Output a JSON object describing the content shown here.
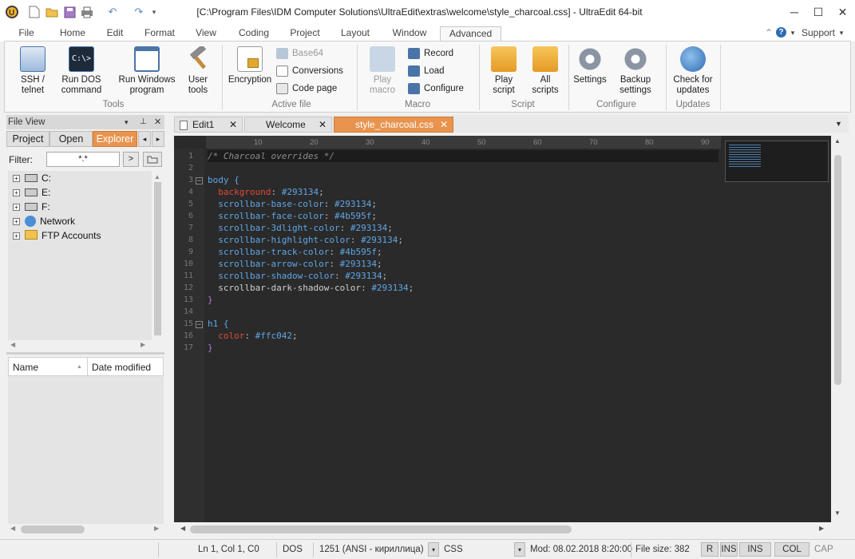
{
  "window": {
    "title": "[C:\\Program Files\\IDM Computer Solutions\\UltraEdit\\extras\\welcome\\style_charcoal.css] - UltraEdit 64-bit",
    "minimize": "─",
    "maximize": "☐",
    "close": "✕"
  },
  "menu_tabs": [
    "File",
    "Home",
    "Edit",
    "Format",
    "View",
    "Coding",
    "Project",
    "Layout",
    "Window",
    "Advanced"
  ],
  "support_label": "Support",
  "ribbon": {
    "tools": {
      "ssh": "SSH /",
      "ssh2": "telnet",
      "dos": "Run DOS",
      "dos2": "command",
      "win": "Run Windows",
      "win2": "program",
      "user": "User",
      "user2": "tools",
      "group": "Tools"
    },
    "active_file": {
      "encryption": "Encryption",
      "base64": "Base64",
      "conversions": "Conversions",
      "codepage": "Code page",
      "group": "Active file"
    },
    "macro": {
      "play": "Play",
      "play2": "macro",
      "record": "Record",
      "load": "Load",
      "configure": "Configure",
      "group": "Macro"
    },
    "script": {
      "play": "Play",
      "play2": "script",
      "all": "All",
      "all2": "scripts",
      "group": "Script"
    },
    "configure": {
      "settings": "Settings",
      "backup": "Backup",
      "backup2": "settings",
      "group": "Configure"
    },
    "updates": {
      "check": "Check for",
      "check2": "updates",
      "group": "Updates"
    }
  },
  "file_view": {
    "title": "File View",
    "tabs": [
      "Project",
      "Open",
      "Explorer"
    ],
    "filter_label": "Filter:",
    "filter_value": "*.*",
    "go_button": ">",
    "tree": [
      "C:",
      "E:",
      "F:",
      "Network",
      "FTP Accounts"
    ],
    "columns": [
      "Name",
      "Date modified"
    ]
  },
  "editor_tabs": [
    "Edit1",
    "Welcome",
    "style_charcoal.css"
  ],
  "ruler_marks": [
    "10",
    "20",
    "30",
    "40",
    "50",
    "60",
    "70",
    "80",
    "90"
  ],
  "code_lines": [
    {
      "n": "1",
      "parts": [
        {
          "t": "/* Charcoal overrides */",
          "c": "#8c8c8c",
          "i": true
        }
      ]
    },
    {
      "n": "2",
      "parts": []
    },
    {
      "n": "3",
      "parts": [
        {
          "t": "body {",
          "c": "#5fa7e8"
        }
      ]
    },
    {
      "n": "4",
      "parts": [
        {
          "t": "  background",
          "c": "#e04a3a"
        },
        {
          "t": ": ",
          "c": "#bbbbbb"
        },
        {
          "t": "#293134",
          "c": "#5fa7e8"
        },
        {
          "t": ";",
          "c": "#bbbbbb"
        }
      ]
    },
    {
      "n": "5",
      "parts": [
        {
          "t": "  scrollbar-base-color",
          "c": "#5fa7e8"
        },
        {
          "t": ": ",
          "c": "#bbbbbb"
        },
        {
          "t": "#293134",
          "c": "#5fa7e8"
        },
        {
          "t": ";",
          "c": "#bbbbbb"
        }
      ]
    },
    {
      "n": "6",
      "parts": [
        {
          "t": "  scrollbar-face-color",
          "c": "#5fa7e8"
        },
        {
          "t": ": ",
          "c": "#bbbbbb"
        },
        {
          "t": "#4b595f",
          "c": "#5fa7e8"
        },
        {
          "t": ";",
          "c": "#bbbbbb"
        }
      ]
    },
    {
      "n": "7",
      "parts": [
        {
          "t": "  scrollbar-3dlight-color",
          "c": "#5fa7e8"
        },
        {
          "t": ": ",
          "c": "#bbbbbb"
        },
        {
          "t": "#293134",
          "c": "#5fa7e8"
        },
        {
          "t": ";",
          "c": "#bbbbbb"
        }
      ]
    },
    {
      "n": "8",
      "parts": [
        {
          "t": "  scrollbar-highlight-color",
          "c": "#5fa7e8"
        },
        {
          "t": ": ",
          "c": "#bbbbbb"
        },
        {
          "t": "#293134",
          "c": "#5fa7e8"
        },
        {
          "t": ";",
          "c": "#bbbbbb"
        }
      ]
    },
    {
      "n": "9",
      "parts": [
        {
          "t": "  scrollbar-track-color",
          "c": "#5fa7e8"
        },
        {
          "t": ": ",
          "c": "#bbbbbb"
        },
        {
          "t": "#4b595f",
          "c": "#5fa7e8"
        },
        {
          "t": ";",
          "c": "#bbbbbb"
        }
      ]
    },
    {
      "n": "10",
      "parts": [
        {
          "t": "  scrollbar-arrow-color",
          "c": "#5fa7e8"
        },
        {
          "t": ": ",
          "c": "#bbbbbb"
        },
        {
          "t": "#293134",
          "c": "#5fa7e8"
        },
        {
          "t": ";",
          "c": "#bbbbbb"
        }
      ]
    },
    {
      "n": "11",
      "parts": [
        {
          "t": "  scrollbar-shadow-color",
          "c": "#5fa7e8"
        },
        {
          "t": ": ",
          "c": "#bbbbbb"
        },
        {
          "t": "#293134",
          "c": "#5fa7e8"
        },
        {
          "t": ";",
          "c": "#bbbbbb"
        }
      ]
    },
    {
      "n": "12",
      "parts": [
        {
          "t": "  scrollbar-dark-shadow-color",
          "c": "#cfcfcf"
        },
        {
          "t": ": ",
          "c": "#bbbbbb"
        },
        {
          "t": "#293134",
          "c": "#5fa7e8"
        },
        {
          "t": ";",
          "c": "#bbbbbb"
        }
      ]
    },
    {
      "n": "13",
      "parts": [
        {
          "t": "}",
          "c": "#b07ad8"
        }
      ]
    },
    {
      "n": "14",
      "parts": []
    },
    {
      "n": "15",
      "parts": [
        {
          "t": "h1 {",
          "c": "#5fa7e8"
        }
      ]
    },
    {
      "n": "16",
      "parts": [
        {
          "t": "  color",
          "c": "#e04a3a"
        },
        {
          "t": ": ",
          "c": "#bbbbbb"
        },
        {
          "t": "#ffc042",
          "c": "#5fa7e8"
        },
        {
          "t": ";",
          "c": "#bbbbbb"
        }
      ]
    },
    {
      "n": "17",
      "parts": [
        {
          "t": "}",
          "c": "#b07ad8"
        }
      ]
    }
  ],
  "status": {
    "position": "Ln 1, Col 1, C0",
    "line_ending": "DOS",
    "encoding": "1251  (ANSI - кириллица)",
    "syntax": "CSS",
    "modified": "Mod: 08.02.2018 8:20:00",
    "file_size": "File size: 382",
    "r": "R",
    "ins1": "INS",
    "ins2": "INS",
    "col": "COL",
    "cap": "CAP"
  },
  "colors": {
    "accent": "#e8944f",
    "editor_bg": "#2a2a2a"
  }
}
